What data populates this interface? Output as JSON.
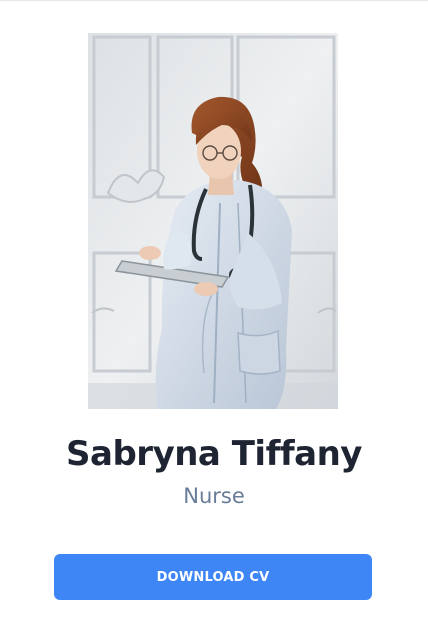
{
  "profile": {
    "name": "Sabryna Tiffany",
    "role": "Nurse",
    "photo_icon": "person-photo"
  },
  "actions": {
    "download_label": "DOWNLOAD CV"
  },
  "colors": {
    "accent": "#3e86f6",
    "name_text": "#1f2433",
    "role_text": "#687d99"
  }
}
